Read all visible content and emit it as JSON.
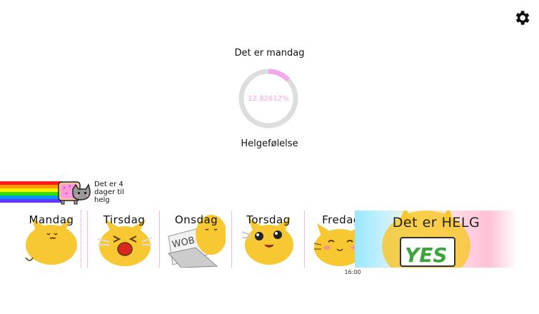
{
  "header": {
    "settings_icon": "gear-icon"
  },
  "status": {
    "today_text": "Det er mandag",
    "progress_percent": 12.82612,
    "progress_text": "12.82612%",
    "caption": "Helgefølelse"
  },
  "countdown": {
    "text": "Det er 4 dager til helg"
  },
  "days": [
    {
      "label": "Mandag"
    },
    {
      "label": "Tirsdag"
    },
    {
      "label": "Onsdag"
    },
    {
      "label": "Torsdag"
    },
    {
      "label": "Fredag"
    }
  ],
  "weekend": {
    "label": "Det er HELG",
    "sign_text": "YES"
  },
  "timeline": {
    "time_label": "16:00"
  },
  "colors": {
    "progress": "#f4a8ec",
    "track": "#dddddd",
    "accent_pink": "#f4b6ea",
    "cat_yellow": "#f8c832"
  }
}
